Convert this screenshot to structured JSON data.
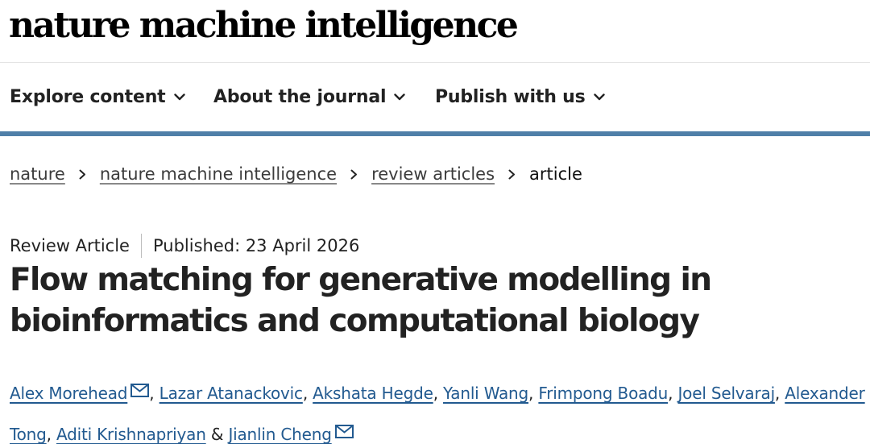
{
  "brand": {
    "logo_text": "nature machine intelligence"
  },
  "nav": {
    "items": [
      {
        "label": "Explore content"
      },
      {
        "label": "About the journal"
      },
      {
        "label": "Publish with us"
      }
    ],
    "accent_color": "#4f7fa8"
  },
  "breadcrumb": {
    "items": [
      "nature",
      "nature machine intelligence",
      "review articles"
    ],
    "current": "article"
  },
  "article": {
    "type": "Review Article",
    "published": "Published: 23 April 2026",
    "title": "Flow matching for generative modelling in bioinformatics and computational biology",
    "authors": [
      "Alex Morehead",
      "Lazar Atanackovic",
      "Akshata Hegde",
      "Yanli Wang",
      "Frimpong Boadu",
      "Joel Selvaraj",
      "Alexander Tong",
      "Aditi Krishnapriyan",
      "Jianlin Cheng"
    ],
    "author_sep": ",",
    "last_sep": "&",
    "link_color": "#225a90",
    "icons": {
      "chevron": "chevron-down-icon",
      "crumb": "chevron-right-icon",
      "corresponding": "mail-icon"
    }
  }
}
